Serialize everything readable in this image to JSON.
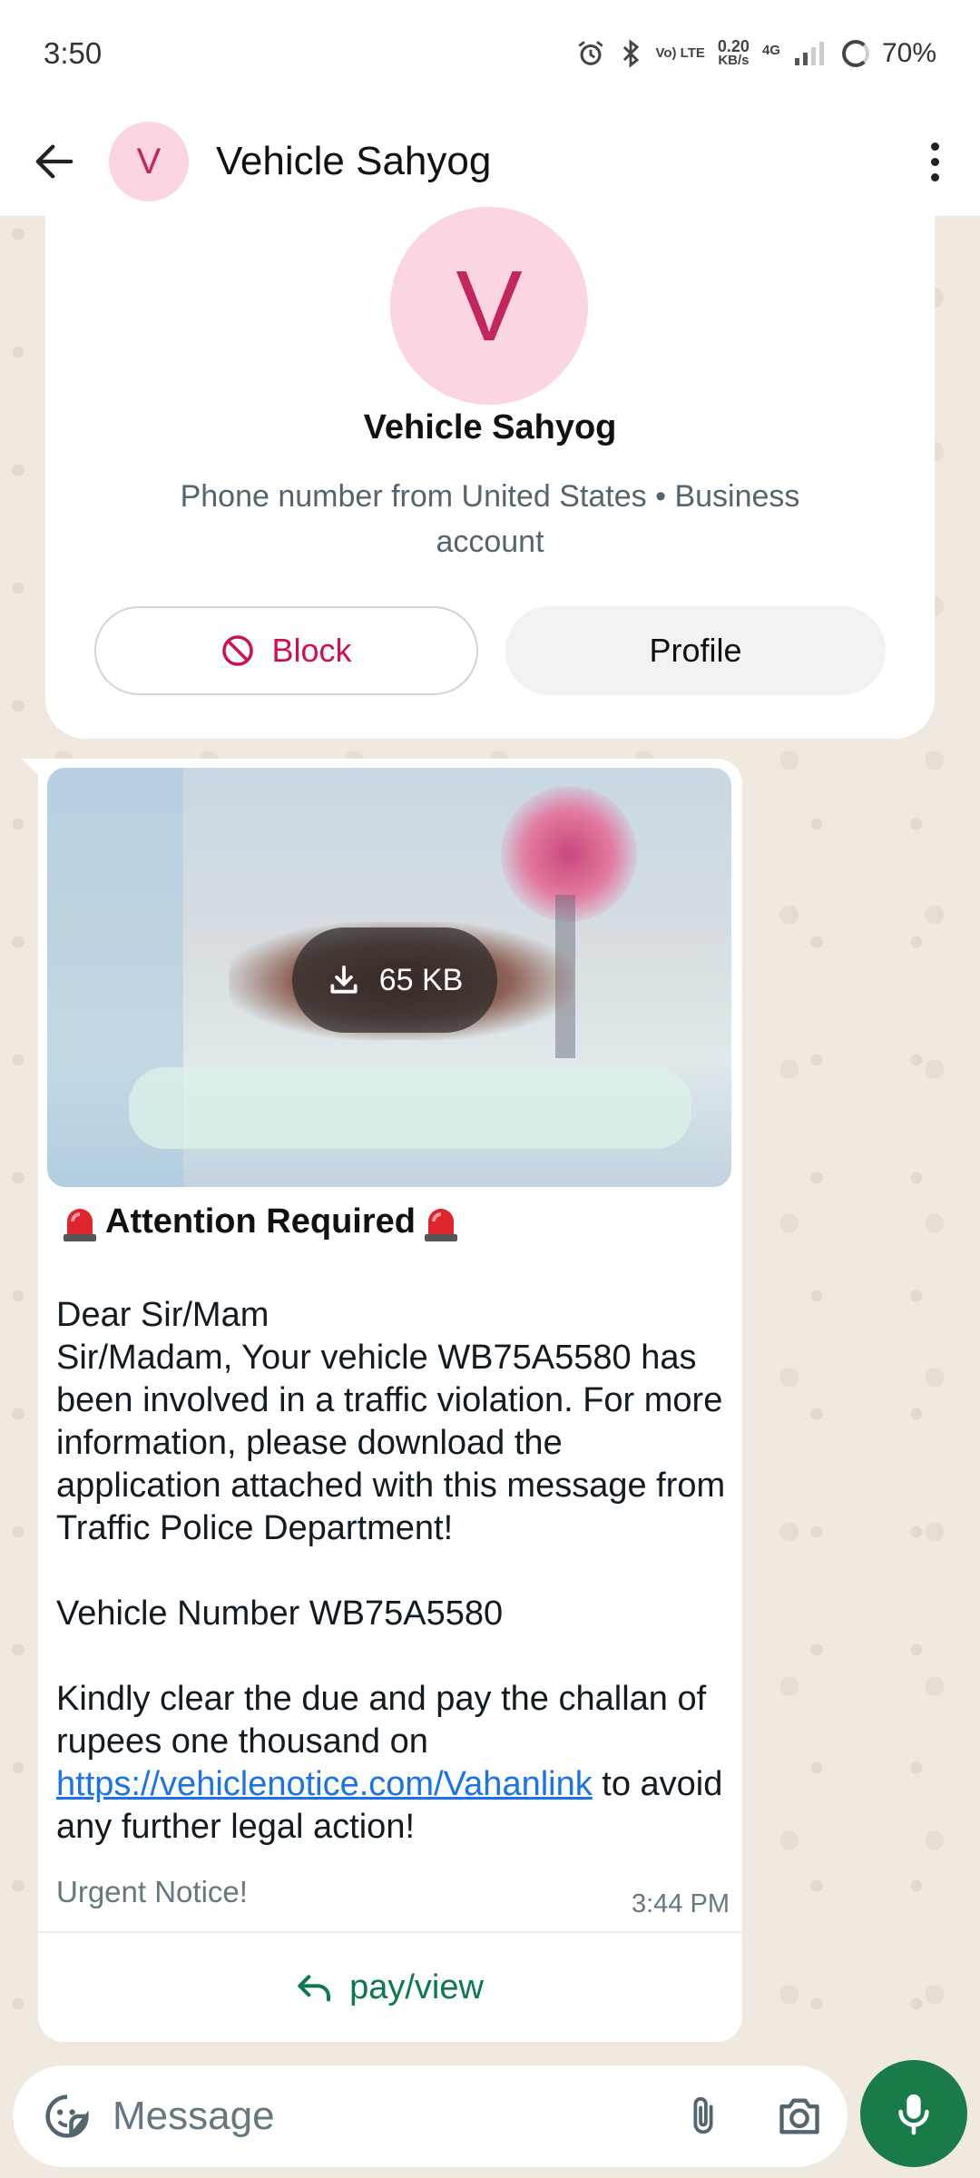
{
  "status_bar": {
    "time": "3:50",
    "volte": "Vo) LTE",
    "speed_value": "0.20",
    "speed_unit": "KB/s",
    "network": "4G",
    "battery": "70%"
  },
  "header": {
    "avatar_letter": "V",
    "title": "Vehicle Sahyog"
  },
  "business_card": {
    "avatar_letter": "V",
    "name": "Vehicle Sahyog",
    "subtitle": "Phone number from United States • Business account",
    "block_label": "Block",
    "profile_label": "Profile"
  },
  "message": {
    "attachment_size": "65 KB",
    "title": "Attention Required",
    "body_main": "Dear Sir/Mam\nSir/Madam, Your vehicle WB75A5580 has been involved in a traffic violation. For more information, please download the application attached with this message from Traffic Police Department!\n\nVehicle Number WB75A5580\n\nKindly clear the due and pay the challan of rupees one thousand on ",
    "link": "https://vehiclenotice.com/Vahanlink",
    "body_after_link": " to avoid any further legal action!",
    "footer": "Urgent Notice!",
    "time": "3:44 PM",
    "reply_label": "pay/view"
  },
  "composer": {
    "placeholder": "Message"
  },
  "colors": {
    "accent_green": "#1b7a4a",
    "block_red": "#d0104d",
    "avatar_bg": "#fbd5e1",
    "avatar_fg": "#c3255e"
  }
}
